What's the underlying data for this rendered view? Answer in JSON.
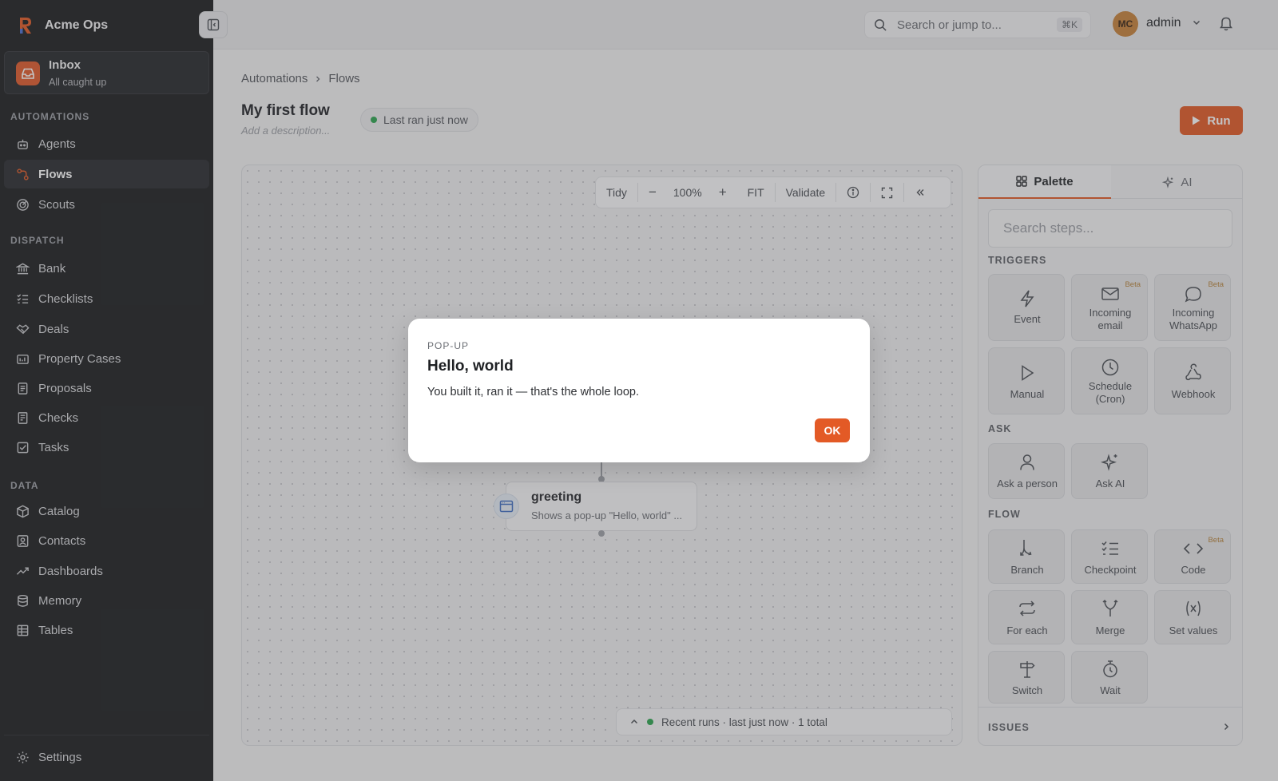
{
  "app": {
    "name": "Acme Ops"
  },
  "inbox": {
    "title": "Inbox",
    "subtitle": "All caught up"
  },
  "sidebar": {
    "sections": [
      {
        "label": "AUTOMATIONS",
        "items": [
          {
            "label": "Agents",
            "icon": "robot-icon"
          },
          {
            "label": "Flows",
            "icon": "flow-icon",
            "active": true
          },
          {
            "label": "Scouts",
            "icon": "radar-icon"
          }
        ]
      },
      {
        "label": "DISPATCH",
        "items": [
          {
            "label": "Bank",
            "icon": "bank-icon"
          },
          {
            "label": "Checklists",
            "icon": "checklist-icon"
          },
          {
            "label": "Deals",
            "icon": "handshake-icon"
          },
          {
            "label": "Property Cases",
            "icon": "folder-icon"
          },
          {
            "label": "Proposals",
            "icon": "document-icon"
          },
          {
            "label": "Checks",
            "icon": "receipt-icon"
          },
          {
            "label": "Tasks",
            "icon": "task-check-icon"
          }
        ]
      },
      {
        "label": "DATA",
        "items": [
          {
            "label": "Catalog",
            "icon": "package-icon"
          },
          {
            "label": "Contacts",
            "icon": "contact-icon"
          },
          {
            "label": "Dashboards",
            "icon": "trend-icon"
          },
          {
            "label": "Memory",
            "icon": "database-icon"
          },
          {
            "label": "Tables",
            "icon": "table-icon"
          }
        ]
      }
    ],
    "settings_label": "Settings"
  },
  "topbar": {
    "search_placeholder": "Search or jump to...",
    "search_shortcut": "⌘K",
    "user_initials": "MC",
    "user_name": "admin"
  },
  "page": {
    "breadcrumb": [
      "Automations",
      "Flows"
    ],
    "title": "My first flow",
    "description_placeholder": "Add a description...",
    "status": "Last ran just now",
    "run_label": "Run"
  },
  "canvas_toolbar": {
    "tidy": "Tidy",
    "zoom_out": "−",
    "zoom": "100%",
    "zoom_in": "+",
    "fit": "FIT",
    "validate": "Validate"
  },
  "node": {
    "title": "greeting",
    "subtitle": "Shows a pop-up \"Hello, world\" ..."
  },
  "recent_runs": {
    "label": "Recent runs · last just now · 1 total"
  },
  "panel": {
    "tabs": {
      "palette": "Palette",
      "ai": "AI"
    },
    "search_placeholder": "Search steps...",
    "categories": {
      "triggers": "TRIGGERS",
      "ask": "ASK",
      "flow": "FLOW"
    },
    "tiles": {
      "event": "Event",
      "incoming_email": "Incoming email",
      "incoming_whatsapp": "Incoming WhatsApp",
      "manual": "Manual",
      "schedule": "Schedule (Cron)",
      "webhook": "Webhook",
      "ask_person": "Ask a person",
      "ask_ai": "Ask AI",
      "branch": "Branch",
      "checkpoint": "Checkpoint",
      "code": "Code",
      "for_each": "For each",
      "merge": "Merge",
      "set_values": "Set values",
      "switch": "Switch",
      "wait": "Wait"
    },
    "beta_label": "Beta",
    "issues_label": "ISSUES"
  },
  "modal": {
    "eyebrow": "POP-UP",
    "title": "Hello, world",
    "body": "You built it, ran it — that's the whole loop.",
    "ok_label": "OK"
  },
  "colors": {
    "accent": "#e35a26",
    "sidebar_bg": "#1d1e20",
    "status_green": "#2da650",
    "beta": "#b7833a"
  }
}
